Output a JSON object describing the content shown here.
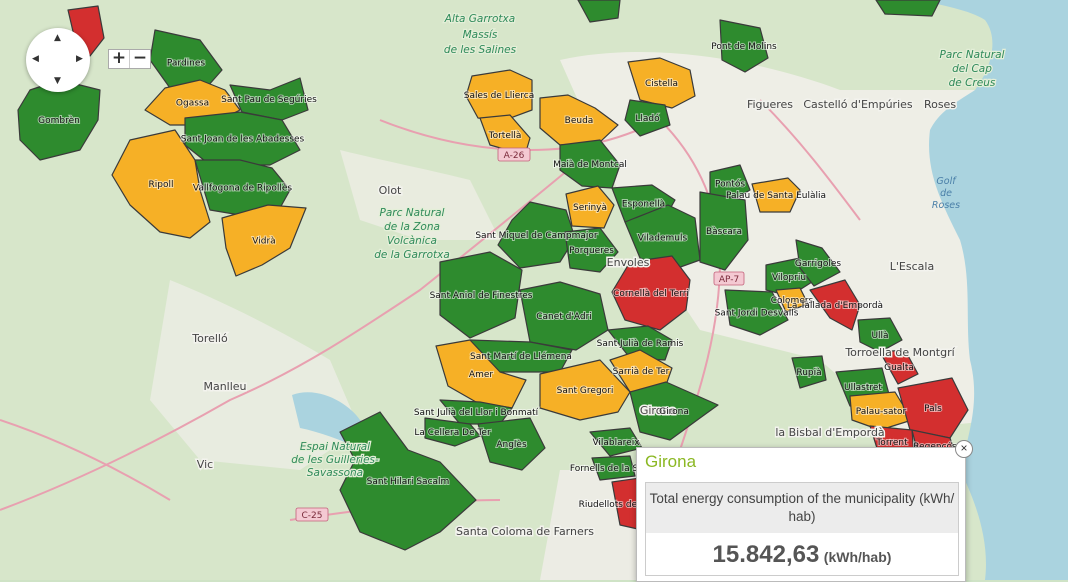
{
  "colors": {
    "high": "#d32f2f",
    "medium": "#f6b026",
    "low": "#2e8b2e",
    "border": "#3a3a3a",
    "sea": "#aad3df"
  },
  "regions": {
    "alta_garrotxa": "Alta Garrotxa",
    "massis": "Massís",
    "salines": "de les Salines",
    "parc_cap_1": "Parc Natural",
    "parc_cap_2": "del Cap",
    "parc_cap_3": "de Creus",
    "golf_1": "Golf",
    "golf_2": "de",
    "golf_3": "Roses",
    "zona_1": "Parc Natural",
    "zona_2": "de la Zona",
    "zona_3": "Volcànica",
    "zona_4": "de la Garrotxa",
    "guilleries_1": "Espai Natural",
    "guilleries_2": "de les Guilleries-",
    "guilleries_3": "Savassona"
  },
  "places": {
    "figueres": "Figueres",
    "castello": "Castelló d'Empúries",
    "roses": "Roses",
    "olot": "Olot",
    "torello": "Torelló",
    "manlleu": "Manlleu",
    "vic": "Vic",
    "lescala": "L'Escala",
    "bisbal": "la Bisbal d'Empordà",
    "torroella": "Torroella de Montgrí",
    "santa_coloma": "Santa Coloma de Farners",
    "gironaplace": "Girona",
    "envoles": "Envoles"
  },
  "roads": {
    "a26": "A-26",
    "ap7": "AP-7",
    "c25": "C-25"
  },
  "municipalities": [
    {
      "name": "Gombrèn",
      "level": "low"
    },
    {
      "name": "Pardines",
      "level": "low"
    },
    {
      "name": "Ogassa",
      "level": "medium"
    },
    {
      "name": "Sant Pau de Segúries",
      "level": "low"
    },
    {
      "name": "Sant Joan de les Abadesses",
      "level": "low"
    },
    {
      "name": "Ripoll",
      "level": "medium"
    },
    {
      "name": "Vallfogona de Ripollès",
      "level": "low"
    },
    {
      "name": "Vidrà",
      "level": "medium"
    },
    {
      "name": "Sales de Llierca",
      "level": "medium"
    },
    {
      "name": "Tortellà",
      "level": "medium"
    },
    {
      "name": "Beuda",
      "level": "medium"
    },
    {
      "name": "Maià de Montcal",
      "level": "low"
    },
    {
      "name": "Pont de Molins",
      "level": "low"
    },
    {
      "name": "Cistella",
      "level": "medium"
    },
    {
      "name": "Lladó",
      "level": "low"
    },
    {
      "name": "Serinyà",
      "level": "medium"
    },
    {
      "name": "Esponellà",
      "level": "low"
    },
    {
      "name": "Pontós",
      "level": "low"
    },
    {
      "name": "Palau de Santa Eulàlia",
      "level": "medium"
    },
    {
      "name": "Sant Miquel de Campmajor",
      "level": "low"
    },
    {
      "name": "Porqueres",
      "level": "low"
    },
    {
      "name": "Vilademuls",
      "level": "low"
    },
    {
      "name": "Bàscara",
      "level": "low"
    },
    {
      "name": "Cornellà del Terri",
      "level": "high"
    },
    {
      "name": "Sant Aniol de Finestres",
      "level": "low"
    },
    {
      "name": "Canet d'Adri",
      "level": "low"
    },
    {
      "name": "Sant Martí de Llémena",
      "level": "low"
    },
    {
      "name": "Sant Julià de Ramis",
      "level": "low"
    },
    {
      "name": "Sarrià de Ter",
      "level": "medium"
    },
    {
      "name": "Amer",
      "level": "medium"
    },
    {
      "name": "Sant Gregori",
      "level": "medium"
    },
    {
      "name": "Girona",
      "level": "low"
    },
    {
      "name": "Sant Julià del Llor i Bonmatí",
      "level": "low"
    },
    {
      "name": "La Cellera De Ter",
      "level": "low"
    },
    {
      "name": "Anglès",
      "level": "low"
    },
    {
      "name": "Sant Hilari Sacalm",
      "level": "low"
    },
    {
      "name": "Vilablareix",
      "level": "low"
    },
    {
      "name": "Fornells de la Selva",
      "level": "low"
    },
    {
      "name": "Riudellots de la Selva",
      "level": "high"
    },
    {
      "name": "Vilopriu",
      "level": "low"
    },
    {
      "name": "Garrigoles",
      "level": "low"
    },
    {
      "name": "Colomers",
      "level": "medium"
    },
    {
      "name": "Sant Jordi Desvalls",
      "level": "low"
    },
    {
      "name": "La Tallada d'Empordà",
      "level": "high"
    },
    {
      "name": "Ullà",
      "level": "low"
    },
    {
      "name": "Gualta",
      "level": "high"
    },
    {
      "name": "Rupià",
      "level": "low"
    },
    {
      "name": "Ullastret",
      "level": "low"
    },
    {
      "name": "Palau-sator",
      "level": "medium"
    },
    {
      "name": "Pals",
      "level": "high"
    },
    {
      "name": "Torrent",
      "level": "high"
    },
    {
      "name": "Regencós",
      "level": "high"
    }
  ],
  "controls": {
    "pan_up": "▲",
    "pan_down": "▼",
    "pan_left": "◀",
    "pan_right": "▶",
    "zoom_in": "+",
    "zoom_out": "−"
  },
  "popup": {
    "title": "Girona",
    "metric_label": "Total energy consumption of the municipality (kWh/ hab)",
    "value": "15.842,63",
    "unit": "(kWh/hab)",
    "close": "×"
  }
}
